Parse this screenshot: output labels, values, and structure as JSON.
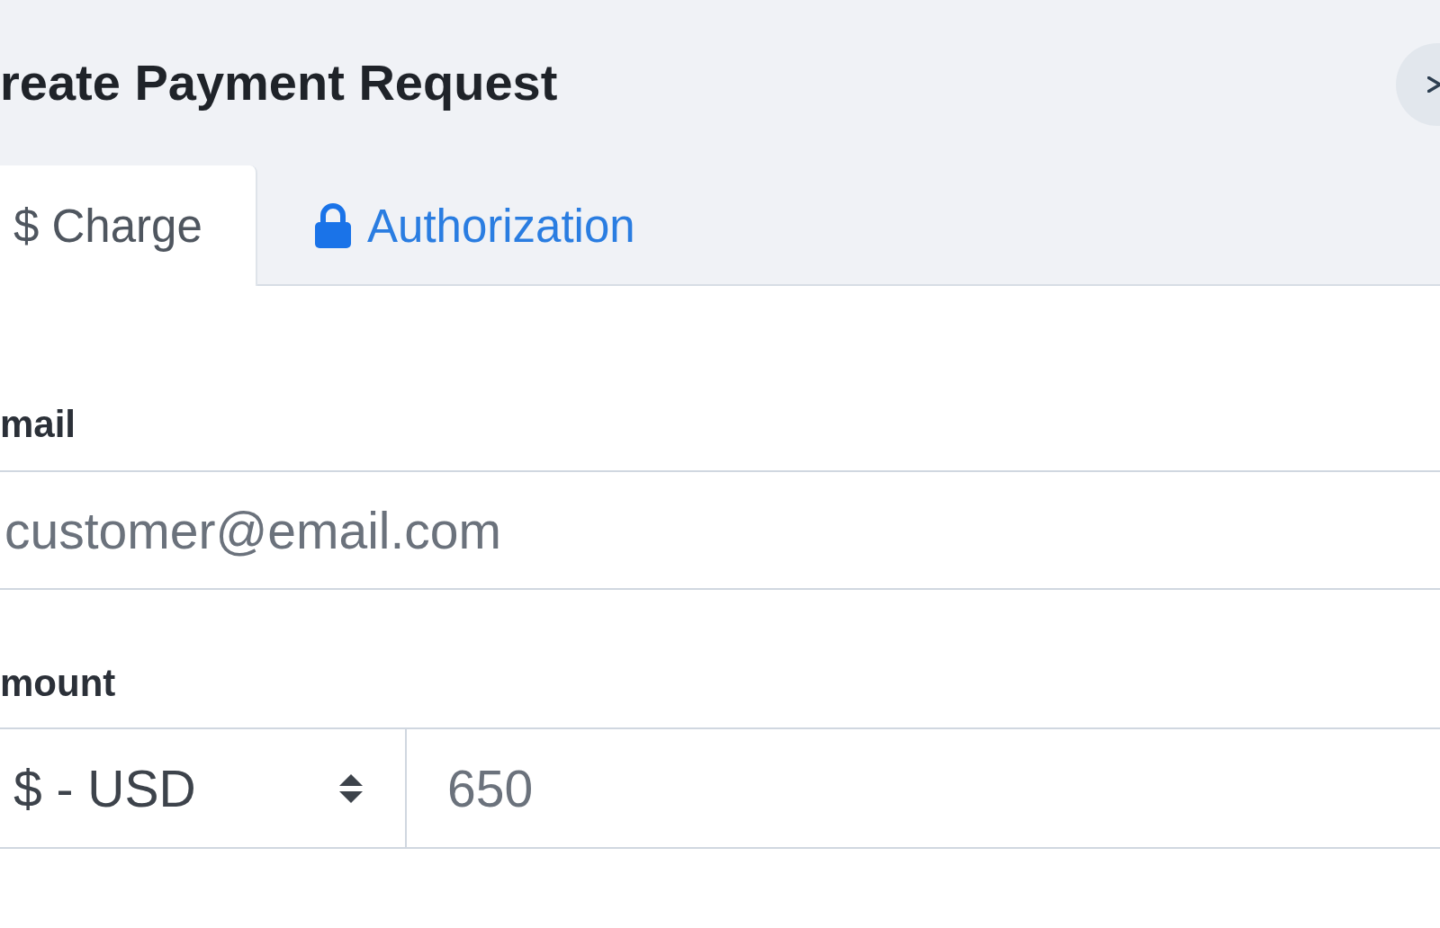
{
  "dialog": {
    "title": "reate Payment Request",
    "tabs": [
      {
        "label": "$ Charge",
        "selected": true
      },
      {
        "label": "Authorization",
        "selected": false
      }
    ],
    "form": {
      "email": {
        "label": "mail",
        "placeholder": "customer@email.com"
      },
      "amount": {
        "label": "mount",
        "currency": "$ - USD",
        "placeholder": "650"
      }
    }
  }
}
